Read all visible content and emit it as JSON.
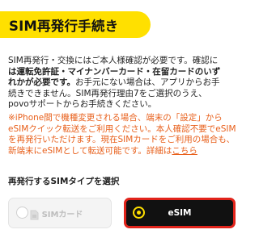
{
  "header": {
    "title": "SIM再発行手続き",
    "accent_color": "#ffe000"
  },
  "intro": {
    "line1_a": "SIM再発行・交換にはご本人様確認が必要です。確認に",
    "line2_bold": "は運転免許証・マイナンバーカード・在留カードのいず",
    "line3_bold": "れかが必要です。",
    "line3_rest": "お手元にない場合は、アプリからお手",
    "line4": "続きできません。SIM再発行理由7をご選択のうえ、",
    "line5": "povoサポートからお手続きください。"
  },
  "note": {
    "text": "※iPhone間で機種変更される場合、端末の「設定」からeSIMクイック転送をご利用ください。本人確認不要でeSIMを再発行いただけます。現在SIMカードをご利用の場合も、新端末にeSIMとして転送可能です。詳細は",
    "link": "こちら",
    "color": "#e8601c"
  },
  "sim_type": {
    "label": "再発行するSIMタイプを選択",
    "options": [
      {
        "label": "SIMカード",
        "icon": "sim-card-icon",
        "selected": false
      },
      {
        "label": "eSIM",
        "icon": "esim-icon",
        "selected": true
      }
    ],
    "highlight_color": "#e1241b"
  }
}
